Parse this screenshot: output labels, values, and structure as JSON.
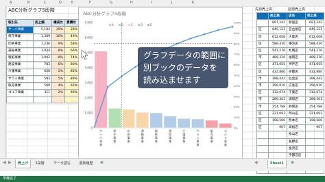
{
  "left_window": {
    "title": "ABC分析グラフ5段階",
    "col_letters": [
      "A",
      "B",
      "C",
      "D",
      "E",
      "F",
      "G",
      "H",
      "I",
      "J",
      "K"
    ],
    "table": {
      "headers": [
        "取引先",
        "売上額",
        "構成比",
        "累積比"
      ],
      "rows": [
        [
          "サーバ事業",
          "5,104",
          "39%",
          "39%"
        ],
        [
          "保守事業",
          "1,309",
          "10%",
          "49%"
        ],
        [
          "印刷事業",
          "1,236",
          "9%",
          "58%"
        ],
        [
          "運輸事業",
          "1,034",
          "8%",
          "66%"
        ],
        [
          "製紙事業",
          "1,002",
          "8%",
          "74%"
        ],
        [
          "建設事業",
          "783",
          "6%",
          "80%"
        ],
        [
          "介護事業",
          "628",
          "5%",
          "85%"
        ],
        [
          "サラミ事業",
          "593",
          "5%",
          "89%"
        ],
        [
          "販売事業",
          "509",
          "4%",
          "93%"
        ],
        [
          "ゴルフ事業",
          "311",
          "2%",
          "96%"
        ],
        [
          "",
          "",
          "",
          ""
        ]
      ]
    },
    "sheet_tabs": [
      "売上げ",
      "5段階",
      "データ読込",
      "更新履歴"
    ],
    "active_tab_index": 0
  },
  "chart": {
    "callout_lines": [
      "グラフデータの範囲に",
      "別ブックのデータを",
      "読み込ませます"
    ]
  },
  "chart_data": {
    "type": "bar",
    "title": "ABC分析グラフ5段階",
    "categories": [
      "サーバ事業",
      "保守事業",
      "印刷事業",
      "運輸事業",
      "製紙事業",
      "建設事業",
      "介護事業",
      "サラミ事業",
      "販売事業",
      "ゴルフ事業"
    ],
    "series": [
      {
        "name": "",
        "type": "bar",
        "values": [
          5104,
          1309,
          1236,
          1034,
          1002,
          783,
          628,
          593,
          509,
          311
        ]
      },
      {
        "name": "",
        "type": "line",
        "axis": "right",
        "values": [
          39,
          49,
          58,
          66,
          74,
          80,
          85,
          89,
          93,
          96
        ]
      }
    ],
    "ylim": [
      0,
      7000
    ],
    "yticks": [
      "0",
      "1,000",
      "2,000",
      "3,000",
      "4,000",
      "5,000",
      "6,000",
      "7,000"
    ],
    "y2lim": [
      0,
      100
    ],
    "y2ticks": [
      "0%",
      "10%",
      "20%",
      "30%",
      "40%",
      "50%",
      "60%",
      "70%",
      "80%",
      "90%",
      "100%"
    ],
    "legend": [
      "A",
      "B",
      "C",
      "D",
      "E"
    ],
    "legend_position": "top",
    "zone_colors": [
      "#f7b3c3",
      "#b3e0b3",
      "#f7d7a8",
      "#b3cde8",
      "#f3a1a8"
    ],
    "line_color": "#5a9fd4",
    "grid": false
  },
  "right_window": {
    "col_titles": [
      "先別売上高",
      "店別売上高"
    ],
    "table": {
      "headers": [
        "",
        "売上高",
        "店名",
        "売上高"
      ],
      "rows": [
        [
          "",
          "697,242",
          "新宿店",
          "697,242"
        ],
        [
          "区",
          "645,121",
          "名古屋店",
          "645,121"
        ],
        [
          "区",
          "612,008",
          "大阪店",
          "612,008"
        ],
        [
          "区",
          "588,430",
          "横浜店",
          "588,430"
        ],
        [
          "区",
          "541,276",
          "札幌店",
          "541,276"
        ],
        [
          "市",
          "489,310",
          "福岡店",
          "489,310"
        ],
        [
          "区",
          "471,055",
          "神戸店",
          "471,055"
        ],
        [
          "区",
          "432,880",
          "京都店",
          "432,880"
        ],
        [
          "市",
          "398,442",
          "仙台店",
          "398,442"
        ],
        [
          "市",
          "356,910",
          "広島店",
          "356,910"
        ],
        [
          "区",
          "312,674",
          "千葉店",
          "312,674"
        ],
        [
          "市",
          "289,301",
          "浦和店",
          "289,301"
        ],
        [
          "市",
          "254,788",
          "静岡店",
          "254,788"
        ],
        [
          "区",
          "221,093",
          "岡山店",
          "221,093"
        ],
        [
          "区",
          "198,560",
          "熊本店",
          "198,560"
        ],
        [
          "区",
          "907",
          "高松店",
          "907"
        ],
        [
          "",
          "",
          "松山店",
          ""
        ],
        [
          "",
          "",
          "長野店",
          ""
        ],
        [
          "",
          "",
          "金沢店",
          ""
        ],
        [
          "",
          "",
          "宇都宮店",
          ""
        ],
        [
          "",
          "",
          "新潟店",
          ""
        ],
        [
          "",
          "",
          "富山店",
          ""
        ]
      ]
    },
    "sheet_tab": "Sheet1"
  },
  "statusbar": {
    "text": "準備完了"
  }
}
